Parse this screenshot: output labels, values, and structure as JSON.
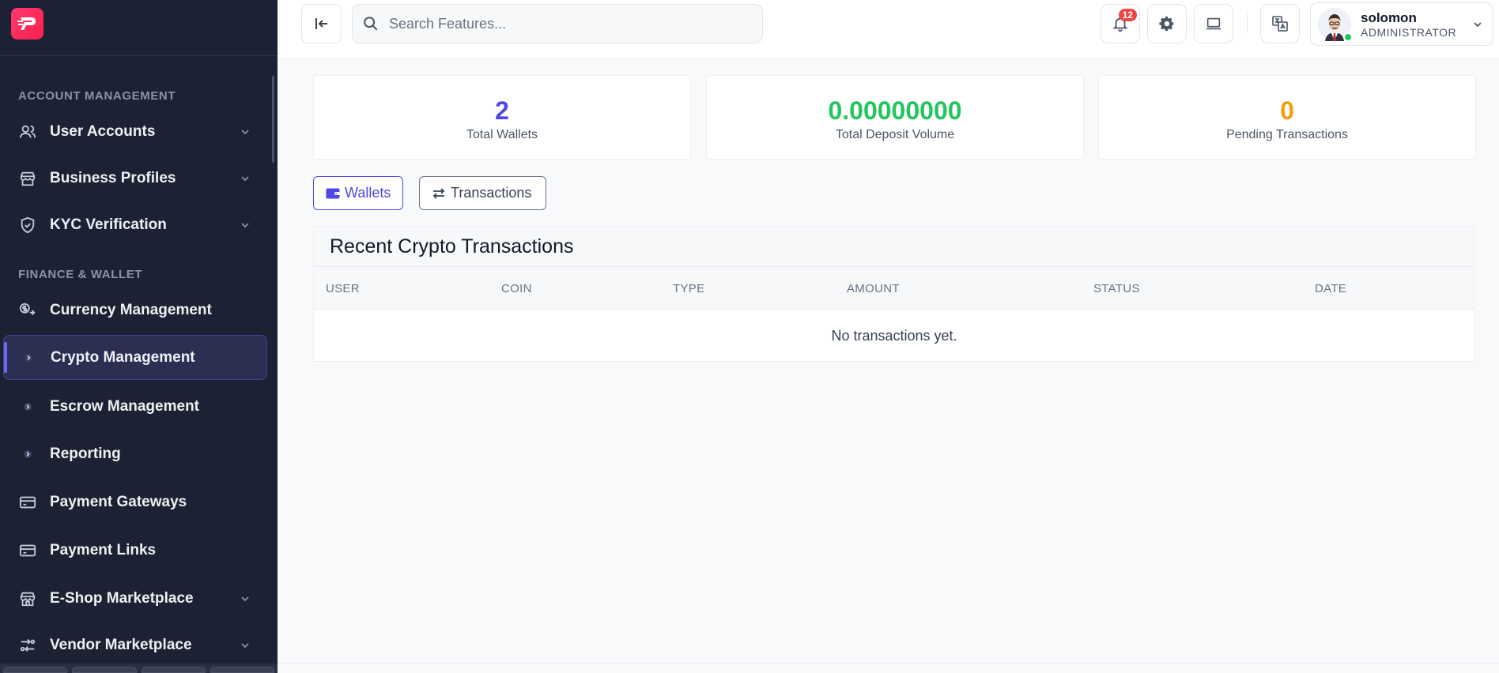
{
  "sidebar": {
    "sections": [
      {
        "title": "ACCOUNT MANAGEMENT"
      },
      {
        "title": "FINANCE & WALLET"
      }
    ],
    "items": [
      {
        "label": "User Accounts",
        "icon": "users-icon",
        "expandable": true
      },
      {
        "label": "Business Profiles",
        "icon": "store-icon",
        "expandable": true
      },
      {
        "label": "KYC Verification",
        "icon": "shield-check-icon",
        "expandable": true
      },
      {
        "label": "Currency Management",
        "icon": "currency-exchange-icon",
        "expandable": false
      },
      {
        "label": "Crypto Management",
        "icon": "bullet-icon",
        "expandable": false,
        "active": true
      },
      {
        "label": "Escrow Management",
        "icon": "bullet-icon",
        "expandable": false
      },
      {
        "label": "Reporting",
        "icon": "bullet-icon",
        "expandable": false
      },
      {
        "label": "Payment Gateways",
        "icon": "credit-card-icon",
        "expandable": false
      },
      {
        "label": "Payment Links",
        "icon": "credit-card-icon",
        "expandable": false
      },
      {
        "label": "E-Shop Marketplace",
        "icon": "shop-icon",
        "expandable": true
      },
      {
        "label": "Vendor Marketplace",
        "icon": "vendor-icon",
        "expandable": true
      }
    ]
  },
  "topbar": {
    "search_placeholder": "Search Features...",
    "notifications_count": "12",
    "user": {
      "name": "solomon",
      "role": "ADMINISTRATOR"
    }
  },
  "stats": [
    {
      "value": "2",
      "label": "Total Wallets",
      "color": "#4f46e5"
    },
    {
      "value": "0.00000000",
      "label": "Total Deposit Volume",
      "color": "#22c55e"
    },
    {
      "value": "0",
      "label": "Pending Transactions",
      "color": "#f59e0b"
    }
  ],
  "tabs": [
    {
      "label": "Wallets",
      "active": true
    },
    {
      "label": "Transactions",
      "active": false
    }
  ],
  "table": {
    "title": "Recent Crypto Transactions",
    "columns": [
      "USER",
      "COIN",
      "TYPE",
      "AMOUNT",
      "STATUS",
      "DATE"
    ],
    "empty_message": "No transactions yet."
  },
  "colors": {
    "accent": "#4f46e5",
    "sidebar_bg": "#1c2233",
    "brand": "#ff1f4b"
  }
}
